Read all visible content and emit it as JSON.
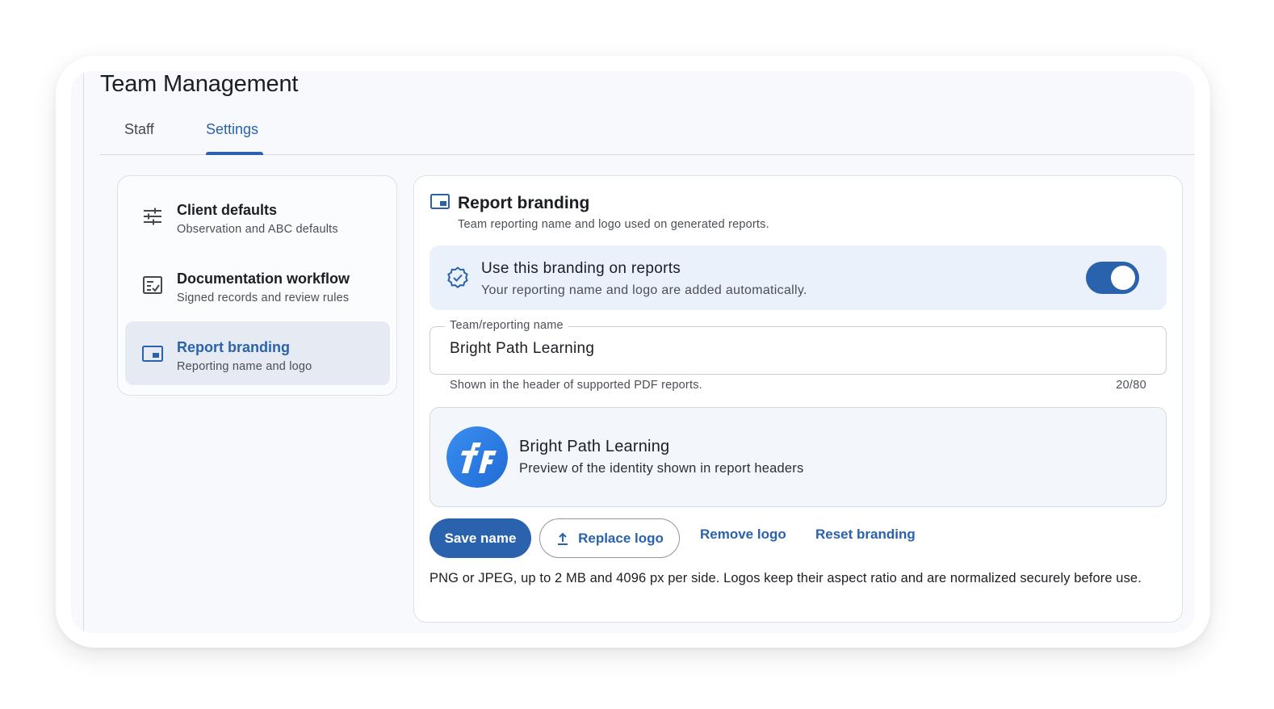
{
  "page": {
    "title": "Team Management"
  },
  "tabs": [
    {
      "label": "Staff",
      "active": false
    },
    {
      "label": "Settings",
      "active": true
    }
  ],
  "nav": {
    "items": [
      {
        "icon": "sliders-icon",
        "title": "Client defaults",
        "subtitle": "Observation and ABC defaults",
        "selected": false
      },
      {
        "icon": "checklist-icon",
        "title": "Documentation workflow",
        "subtitle": "Signed records and review rules",
        "selected": false
      },
      {
        "icon": "picture-in-picture-icon",
        "title": "Report branding",
        "subtitle": "Reporting name and logo",
        "selected": true
      }
    ]
  },
  "section": {
    "icon": "picture-in-picture-icon",
    "title": "Report branding",
    "subtitle": "Team reporting name and logo used on generated reports."
  },
  "branding_toggle": {
    "icon": "verified-badge-icon",
    "title": "Use this branding on reports",
    "subtitle": "Your reporting name and logo are added automatically.",
    "enabled": true
  },
  "name_field": {
    "label": "Team/reporting name",
    "value": "Bright Path Learning",
    "helper": "Shown in the header of supported PDF reports.",
    "counter": "20/80"
  },
  "preview": {
    "name": "Bright Path Learning",
    "subtitle": "Preview of the identity shown in report headers"
  },
  "actions": {
    "save_label": "Save name",
    "replace_label": "Replace logo",
    "remove_label": "Remove logo",
    "reset_label": "Reset branding"
  },
  "footnote": "PNG or JPEG, up to 2 MB and 4096 px per side. Logos keep their aspect ratio and are normalized securely before use.",
  "colors": {
    "accent": "#2a62ad",
    "toggle_bg": "#eaf1fb",
    "selected_nav_bg": "#e6ebf3"
  }
}
